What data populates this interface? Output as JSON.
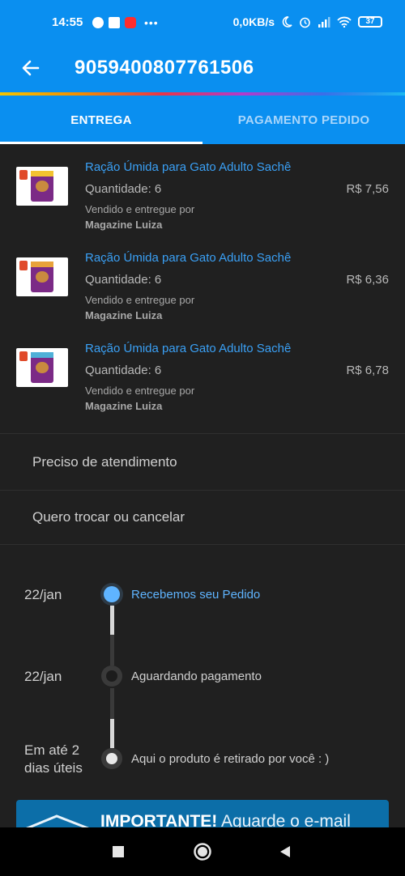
{
  "status_bar": {
    "time": "14:55",
    "dots": "•••",
    "network_speed": "0,0KB/s",
    "battery": "37"
  },
  "header": {
    "back_icon": "arrow-left-icon",
    "order_number": "9059400807761506"
  },
  "tabs": [
    {
      "label": "ENTREGA",
      "active": true
    },
    {
      "label": "PAGAMENTO PEDIDO",
      "active": false
    }
  ],
  "products": [
    {
      "name": "Ração Úmida para Gato Adulto Sachê",
      "quantity": "Quantidade: 6",
      "price": "R$ 7,56",
      "sold_by": "Vendido e entregue por",
      "seller": "Magazine Luiza",
      "band_color": "#f2c230"
    },
    {
      "name": "Ração Úmida para Gato Adulto Sachê",
      "quantity": "Quantidade: 6",
      "price": "R$ 6,36",
      "sold_by": "Vendido e entregue por",
      "seller": "Magazine Luiza",
      "band_color": "#e8a23a"
    },
    {
      "name": "Ração Úmida para Gato Adulto Sachê",
      "quantity": "Quantidade: 6",
      "price": "R$ 6,78",
      "sold_by": "Vendido e entregue por",
      "seller": "Magazine Luiza",
      "band_color": "#4fb0d8"
    }
  ],
  "menu": [
    {
      "label": "Preciso de atendimento"
    },
    {
      "label": "Quero trocar ou cancelar"
    }
  ],
  "timeline": [
    {
      "date": "22/jan",
      "label": "Recebemos seu Pedido",
      "state": "done"
    },
    {
      "date": "22/jan",
      "label": "Aguardando pagamento",
      "state": "pending"
    },
    {
      "date_line1": "Em até 2",
      "date_line2": "dias úteis",
      "label": "Aqui o produto é retirado por você : )",
      "state": "final"
    }
  ],
  "notice": {
    "bold": "IMPORTANTE!",
    "text": " Aguarde o e-mail"
  },
  "nav": {
    "recents_icon": "square-icon",
    "home_icon": "circle-icon",
    "back_icon": "triangle-back-icon"
  },
  "colors": {
    "primary": "#0a8ff0",
    "background": "#202020",
    "link": "#3aa0f5",
    "timeline_active": "#5fb4ff",
    "notice_bg": "#0c6ea8"
  }
}
